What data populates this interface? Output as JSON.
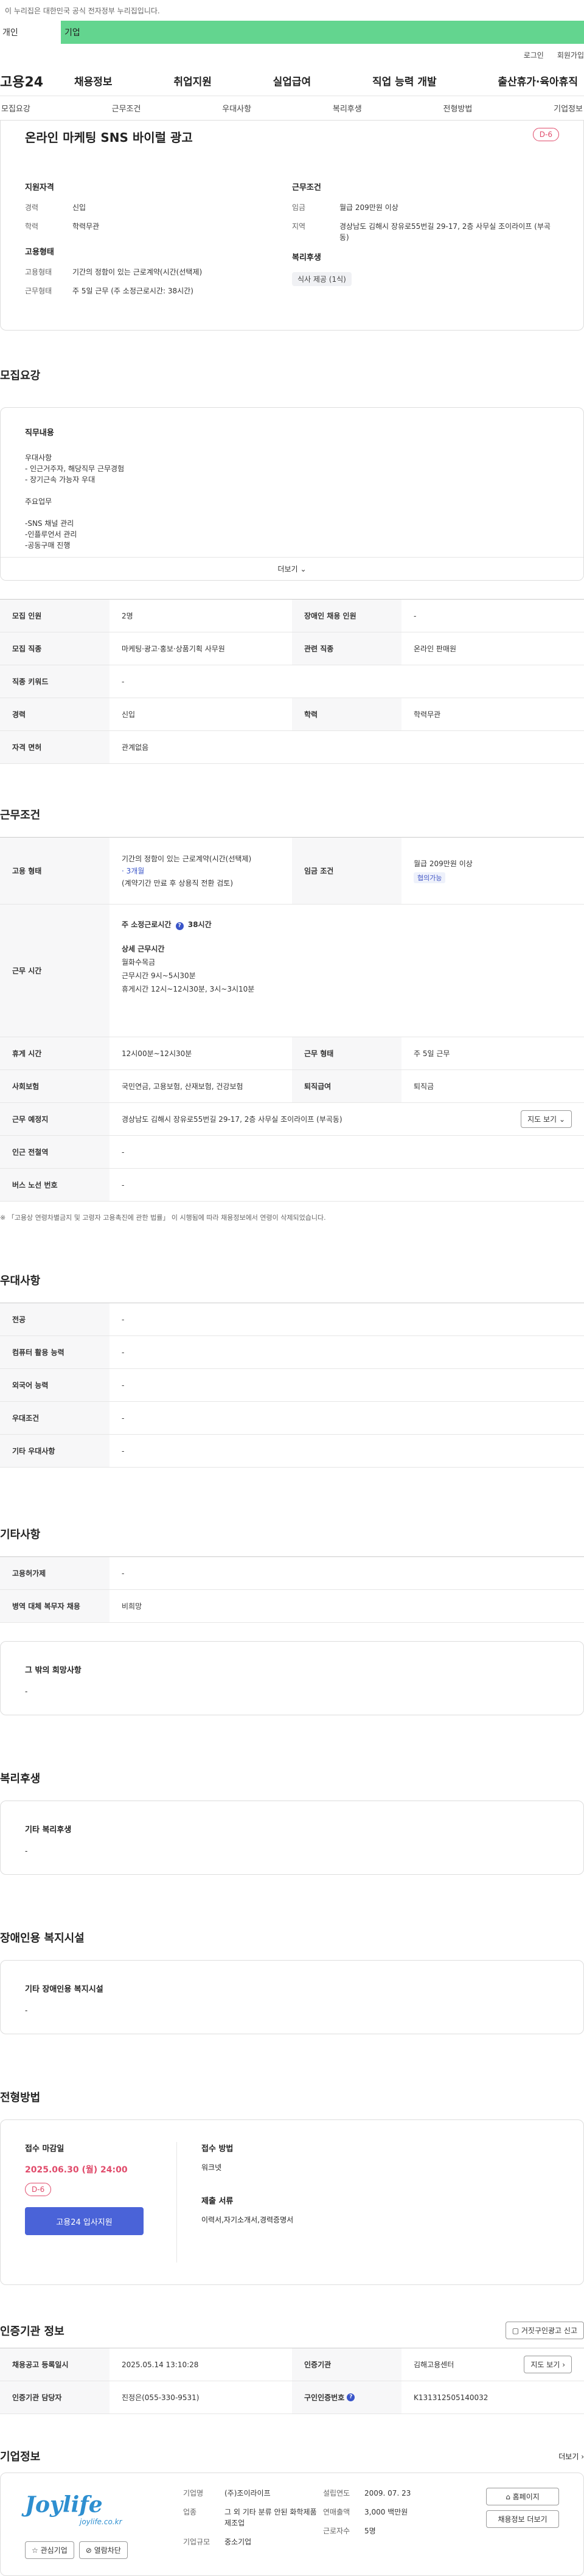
{
  "notice": "이 누리집은 대한민국 공식 전자정부 누리집입니다.",
  "mode": {
    "personal": "개인",
    "company": "기업"
  },
  "util": {
    "login": "로그인",
    "join": "회원가입"
  },
  "brand": "고용24",
  "gnb": [
    "채용정보",
    "취업지원",
    "실업급여",
    "직업 능력 개발",
    "출산휴가·육아휴직"
  ],
  "subnav": [
    "모집요강",
    "근무조건",
    "우대사항",
    "복리후생",
    "전형방법",
    "기업정보"
  ],
  "summary": {
    "title": "온라인 마케팅 SNS 바이럴 광고",
    "dday": "D-6",
    "qual_title": "지원자격",
    "qual": [
      {
        "k": "경력",
        "v": "신입"
      },
      {
        "k": "학력",
        "v": "학력무관"
      }
    ],
    "cond_title": "근무조건",
    "cond": [
      {
        "k": "임금",
        "v": "월급 209만원 이상"
      },
      {
        "k": "지역",
        "v": "경상남도 김해시 장유로55번길 29-17, 2층 사무실 조이라이프 (부곡동)"
      }
    ],
    "emp_title": "고용형태",
    "emp": [
      {
        "k": "고용형태",
        "v": "기간의 정함이 있는 근로계약(시간(선택제)"
      },
      {
        "k": "근무형태",
        "v": "주 5일 근무 (주 소정근로시간: 38시간)"
      }
    ],
    "welfare_title": "복리후생",
    "welfare_chip": "식사 제공 (1식)"
  },
  "recruit": {
    "title": "모집요강",
    "job_title": "직무내용",
    "job_lines": [
      "우대사항",
      "- 인근거주자, 해당직무 근무경험",
      "- 장기근속 가능자 우대",
      "",
      "주요업무",
      "",
      "-SNS 채널 관리",
      "-인플루언서 관리",
      "-공동구매 진행"
    ],
    "more": "더보기",
    "rows": [
      {
        "k1": "모집 인원",
        "v1": "2명",
        "k2": "장애인 채용 인원",
        "v2": "-"
      },
      {
        "k1": "모집 직종",
        "v1": "마케팅·광고·홍보·상품기획 사무원",
        "k2": "관련 직종",
        "v2": "온라인 판매원"
      },
      {
        "k1": "직종 키워드",
        "v1": "-",
        "k2": "",
        "v2": ""
      },
      {
        "k1": "경력",
        "v1": "신입",
        "k2": "학력",
        "v2": "학력무관"
      },
      {
        "k1": "자격 면허",
        "v1": "관계없음",
        "k2": "",
        "v2": ""
      }
    ]
  },
  "work": {
    "title": "근무조건",
    "emp_k": "고용 형태",
    "emp_v1": "기간의 정함이 있는 근로계약(시간(선택제)",
    "emp_v2": "· 3개월",
    "emp_v3": "(계약기간 만료 후 상용직 전환 검토)",
    "wage_k": "임금 조건",
    "wage_v": "월급 209만원 이상",
    "wage_chip": "협의가능",
    "time_k": "근무 시간",
    "time_week": "주 소정근로시간",
    "time_week_v": "38시간",
    "time_detail_title": "상세 근무시간",
    "time_lines": [
      "월화수목금",
      "근무시간 9시~5시30분",
      "휴게시간 12시~12시30분, 3시~3시10분"
    ],
    "rest_k": "휴게 시간",
    "rest_v": "12시00분~12시30분",
    "form_k": "근무 형태",
    "form_v": "주 5일 근무",
    "ins_k": "사회보험",
    "ins_v": "국민연금, 고용보험, 산재보험, 건강보험",
    "ret_k": "퇴직급여",
    "ret_v": "퇴직금",
    "place_k": "근무 예정지",
    "place_v": "경상남도 김해시 장유로55번길 29-17, 2층 사무실 조이라이프 (부곡동)",
    "map_btn": "지도 보기",
    "subway_k": "인근 전철역",
    "subway_v": "-",
    "bus_k": "버스 노선 번호",
    "bus_v": "-",
    "note": "※ 「고용상 연령차별금지 및 고령자 고용촉진에 관한 법률」 이 시행됨에 따라 채용정보에서 연령이 삭제되었습니다."
  },
  "pref": {
    "title": "우대사항",
    "rows": [
      {
        "k": "전공",
        "v": "-"
      },
      {
        "k": "컴퓨터 활용 능력",
        "v": "-"
      },
      {
        "k": "외국어 능력",
        "v": "-"
      },
      {
        "k": "우대조건",
        "v": "-"
      },
      {
        "k": "기타 우대사항",
        "v": "-"
      }
    ]
  },
  "etc": {
    "title": "기타사항",
    "rows": [
      {
        "k": "고용허가제",
        "v": "-"
      },
      {
        "k": "병역 대체 복무자 채용",
        "v": "비희망"
      }
    ],
    "box_title": "그 밖의 희망사항",
    "box_v": "-"
  },
  "welfare": {
    "title": "복리후생",
    "box_title": "기타 복리후생",
    "box_v": "-"
  },
  "disabled": {
    "title": "장애인용 복지시설",
    "box_title": "기타 장애인용 복지시설",
    "box_v": "-"
  },
  "process": {
    "title": "전형방법",
    "deadline_k": "접수 마감일",
    "deadline_v": "2025.06.30 (월) 24:00",
    "dday": "D-6",
    "apply_btn": "고용24 입사지원",
    "method_k": "접수 방법",
    "method_v": "워크넷",
    "docs_k": "제출 서류",
    "docs_v": "이력서,자기소개서,경력증명서"
  },
  "cert": {
    "title": "인증기관 정보",
    "report_btn": "거짓구인광고 신고",
    "reg_k": "채용공고 등록일시",
    "reg_v": "2025.05.14 13:10:28",
    "org_k": "인증기관",
    "org_v": "김해고용센터",
    "map_btn": "지도 보기",
    "mgr_k": "인증기관 담당자",
    "mgr_v": "진정은(055-330-9531)",
    "id_k": "구인인증번호",
    "id_v": "K131312505140032"
  },
  "company": {
    "title": "기업정보",
    "more": "더보기",
    "logo_text": "Joylife",
    "logo_sub": "joylife.co.kr",
    "fav_btn": "관심기업",
    "block_btn": "열람차단",
    "name_k": "기업명",
    "name_v": "(주)조이라이프",
    "ind_k": "업종",
    "ind_v": "그 외 기타 분류 안된 화학제품 제조업",
    "size_k": "기업규모",
    "size_v": "중소기업",
    "est_k": "설립연도",
    "est_v": "2009. 07. 23",
    "sales_k": "연매출액",
    "sales_v": "3,000 백만원",
    "emp_k": "근로자수",
    "emp_v": "5명",
    "home_btn": "홈페이지",
    "jobs_btn": "채용정보 더보기"
  }
}
